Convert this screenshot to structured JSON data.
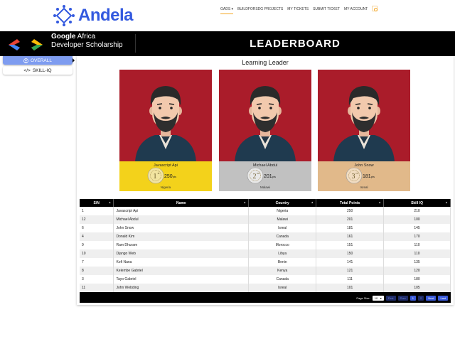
{
  "header": {
    "brand": "Andela",
    "nav": [
      {
        "label": "GADS ▾",
        "active": true
      },
      {
        "label": "BUILDFORSDG PROJECTS",
        "active": false
      },
      {
        "label": "MY TICKETS",
        "active": false
      },
      {
        "label": "SUBMIT TICKET",
        "active": false
      },
      {
        "label": "MY ACCOUNT",
        "active": false
      }
    ],
    "search_icon": "search-icon"
  },
  "banner": {
    "line1_bold": "Google",
    "line1_rest": " Africa",
    "line2": "Developer Scholarship",
    "title": "LEADERBOARD"
  },
  "sidebar": {
    "items": [
      {
        "label": "OVERALL",
        "icon": "user-circle-icon",
        "active": true
      },
      {
        "label": "SKILL-IQ",
        "icon": "code-icon",
        "active": false
      }
    ]
  },
  "leaders": {
    "title": "Learning Leader",
    "cards": [
      {
        "name": "Javascript Api",
        "rank": "1",
        "suffix": "st",
        "points": "250",
        "unit": "pts",
        "country": "Nigeria",
        "foot_color": "#f3d21b",
        "medal_color": "#f2e4a0"
      },
      {
        "name": "Michael Abdul",
        "rank": "2",
        "suffix": "nd",
        "points": "201",
        "unit": "pts",
        "country": "Malawi",
        "foot_color": "#c1c1c1",
        "medal_color": "#e8e8e8"
      },
      {
        "name": "John Snow",
        "rank": "3",
        "suffix": "rd",
        "points": "181",
        "unit": "pts",
        "country": "Isreal",
        "foot_color": "#e1b98a",
        "medal_color": "#f1dcc1"
      }
    ]
  },
  "table": {
    "columns": [
      "S/N",
      "Name",
      "Country",
      "Total Points",
      "Skill IQ"
    ],
    "rows": [
      [
        "1",
        "Javascript Api",
        "Nigeria",
        "250",
        "210"
      ],
      [
        "12",
        "Michael Abdul",
        "Malawi",
        "201",
        "100"
      ],
      [
        "6",
        "John Snow",
        "Isreal",
        "181",
        "145"
      ],
      [
        "4",
        "Donald Kim",
        "Canada",
        "161",
        "170"
      ],
      [
        "9",
        "Ram Dhuram",
        "Morocco",
        "151",
        "110"
      ],
      [
        "10",
        "Django Web",
        "Libya",
        "150",
        "110"
      ],
      [
        "7",
        "Kofi Nana",
        "Benin",
        "141",
        "135"
      ],
      [
        "8",
        "Kelembe Gabriel",
        "Kenya",
        "121",
        "120"
      ],
      [
        "3",
        "Tayo Gabriel",
        "Canada",
        "111",
        "180"
      ],
      [
        "11",
        "John Webding",
        "Isreal",
        "101",
        "105"
      ]
    ],
    "pager": {
      "page_size_label": "Page Size:",
      "page_size_value": "10",
      "first": "First",
      "prev": "Prev",
      "page1": "1",
      "page2": "2",
      "next": "Next",
      "last": "Last"
    }
  },
  "colors": {
    "brand_blue": "#3359df",
    "card_red": "#aa1c2a",
    "active_tab": "#7e9cf0"
  }
}
